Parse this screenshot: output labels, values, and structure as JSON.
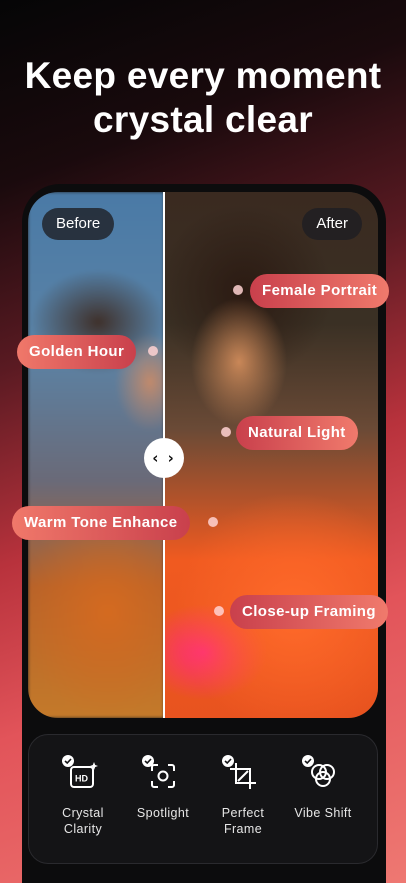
{
  "headline": {
    "line1": "Keep every moment",
    "line2": "crystal clear"
  },
  "compare": {
    "before_label": "Before",
    "after_label": "After",
    "handle_glyph": "‹ ›"
  },
  "callouts": [
    "Female Portrait",
    "Golden Hour",
    "Natural Light",
    "Warm Tone Enhance",
    "Close-up Framing"
  ],
  "features": [
    {
      "label": "Crystal Clarity",
      "line1": "Crystal",
      "line2": "Clarity",
      "icon": "hd-sparkle-icon"
    },
    {
      "label": "Spotlight",
      "line1": "Spotlight",
      "line2": "",
      "icon": "focus-target-icon"
    },
    {
      "label": "Perfect Frame",
      "line1": "Perfect",
      "line2": "Frame",
      "icon": "crop-frame-icon"
    },
    {
      "label": "Vibe Shift",
      "line1": "Vibe Shift",
      "line2": "",
      "icon": "color-circles-icon"
    }
  ],
  "colors": {
    "accent": "#e2545a",
    "pill_dark": "#c9404c",
    "pill_light": "#f0786a"
  }
}
